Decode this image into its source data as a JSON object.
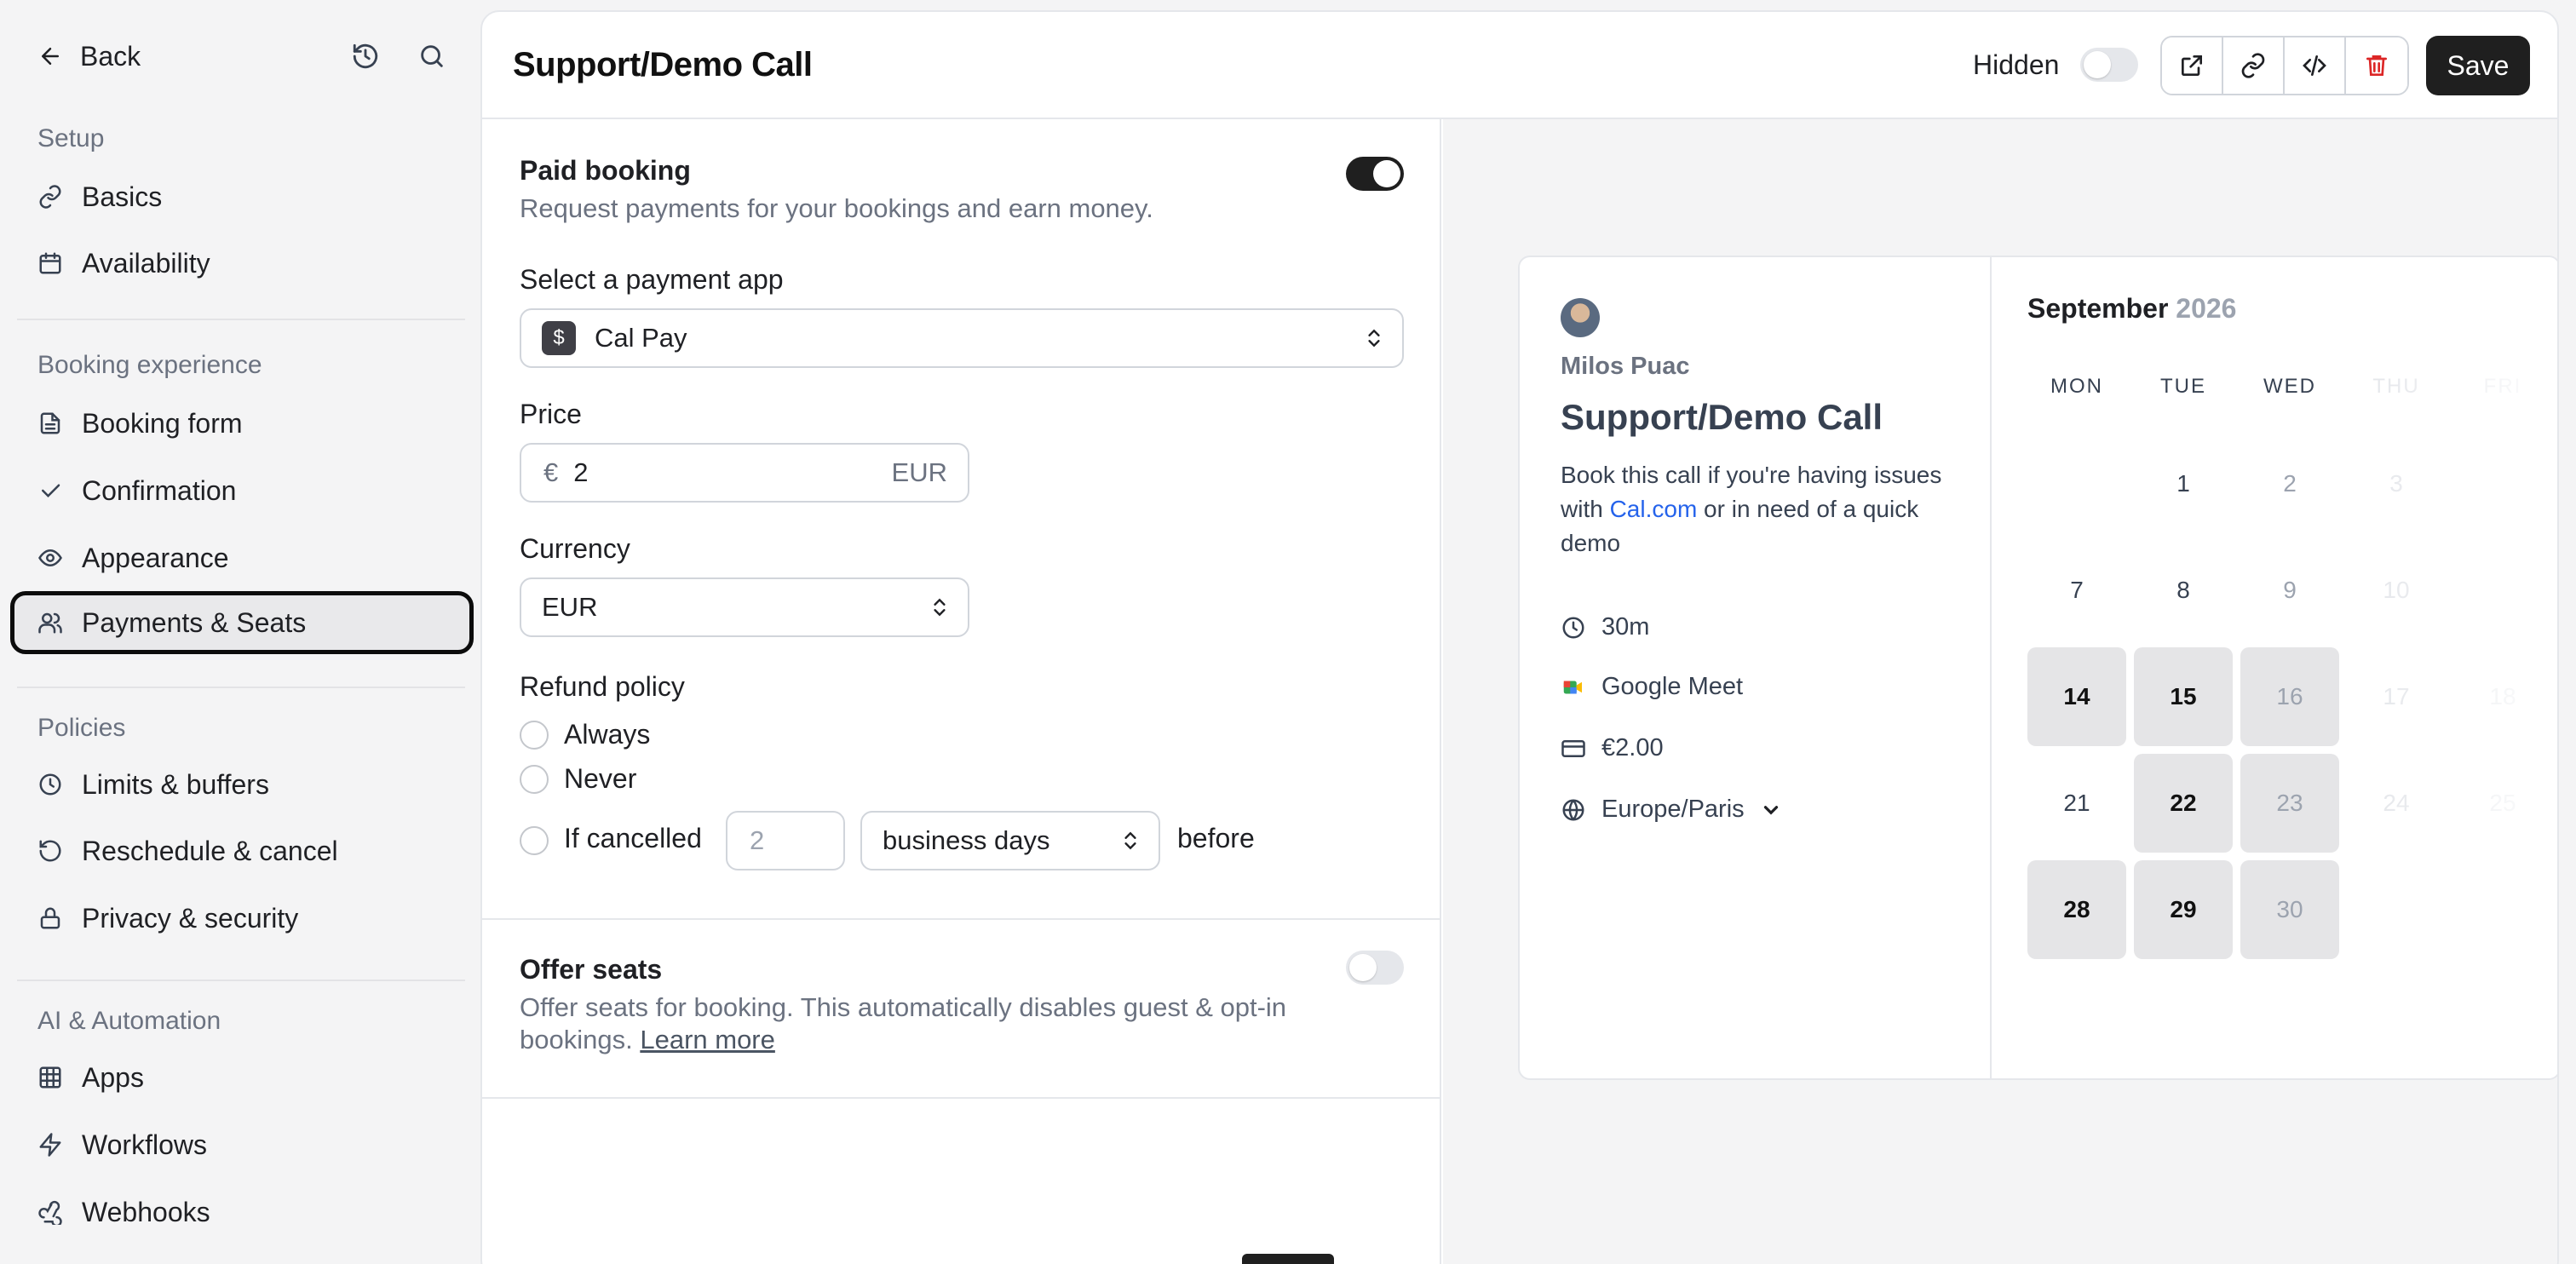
{
  "sidebar": {
    "back_label": "Back",
    "groups": {
      "setup": "Setup",
      "booking": "Booking experience",
      "policies": "Policies",
      "ai": "AI & Automation"
    },
    "items": [
      {
        "label": "Basics",
        "icon": "link-icon"
      },
      {
        "label": "Availability",
        "icon": "calendar-icon"
      },
      {
        "label": "Booking form",
        "icon": "document-icon"
      },
      {
        "label": "Confirmation",
        "icon": "check-icon"
      },
      {
        "label": "Appearance",
        "icon": "eye-icon"
      },
      {
        "label": "Payments & Seats",
        "icon": "users-icon"
      },
      {
        "label": "Limits & buffers",
        "icon": "clock-icon"
      },
      {
        "label": "Reschedule & cancel",
        "icon": "history-icon"
      },
      {
        "label": "Privacy & security",
        "icon": "lock-icon"
      },
      {
        "label": "Apps",
        "icon": "grid-icon"
      },
      {
        "label": "Workflows",
        "icon": "zap-icon"
      },
      {
        "label": "Webhooks",
        "icon": "webhook-icon"
      }
    ]
  },
  "header": {
    "title": "Support/Demo Call",
    "hidden_label": "Hidden",
    "save_label": "Save"
  },
  "form": {
    "paid_booking": {
      "title": "Paid booking",
      "description": "Request payments for your bookings and earn money.",
      "enabled": true
    },
    "payment_app": {
      "label": "Select a payment app",
      "value": "Cal Pay"
    },
    "price": {
      "label": "Price",
      "symbol": "€",
      "value": "2",
      "suffix": "EUR"
    },
    "currency": {
      "label": "Currency",
      "value": "EUR"
    },
    "refund": {
      "label": "Refund policy",
      "always": "Always",
      "never": "Never",
      "if_cancelled": "If cancelled",
      "days_placeholder": "2",
      "unit": "business days",
      "after": "before"
    },
    "seats": {
      "title": "Offer seats",
      "description": "Offer seats for booking. This automatically disables guest & opt-in bookings.",
      "learn_more": "Learn more",
      "enabled": false
    }
  },
  "preview": {
    "host": "Milos Puac",
    "title": "Support/Demo Call",
    "desc_before": "Book this call if you're having issues with ",
    "desc_link": "Cal.com",
    "desc_after": " or in need of a quick demo",
    "duration": "30m",
    "location": "Google Meet",
    "price": "€2.00",
    "timezone": "Europe/Paris",
    "month": "September",
    "year": "2026",
    "weekdays": [
      "MON",
      "TUE",
      "WED",
      "THU",
      "FRI"
    ],
    "weeks": [
      [
        "",
        "1",
        "2",
        "3",
        ""
      ],
      [
        "7",
        "8",
        "9",
        "10",
        ""
      ],
      [
        "14",
        "15",
        "16",
        "17",
        "18"
      ],
      [
        "21",
        "22",
        "23",
        "24",
        "25"
      ],
      [
        "28",
        "29",
        "30",
        "",
        ""
      ]
    ]
  },
  "colors": {
    "accent": "#1f1f1f",
    "link": "#2563eb",
    "danger": "#dc2626",
    "available_day": "#e5e5e7"
  }
}
